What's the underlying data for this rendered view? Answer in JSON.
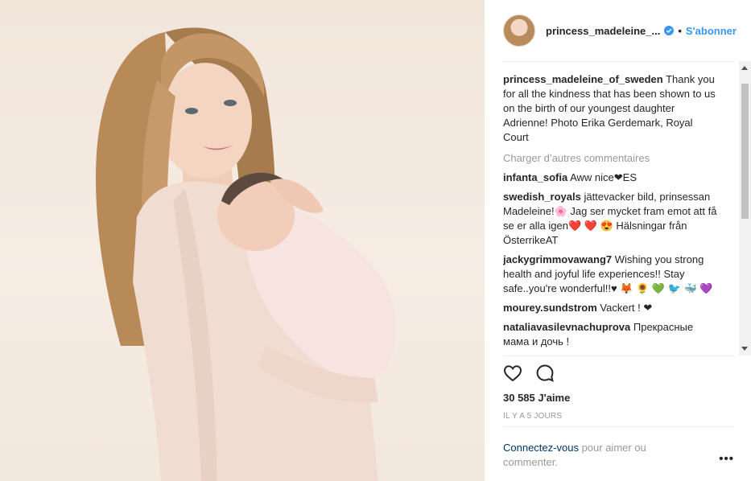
{
  "photo": {
    "alt": ""
  },
  "header": {
    "username": "princess_madeleine_...",
    "separator": "•",
    "follow_label": "S'abonner"
  },
  "caption": {
    "author": "princess_madeleine_of_sweden",
    "text": "Thank you for all the kindness that has been shown to us on the birth of our youngest daughter Adrienne! Photo Erika Gerdemark, Royal Court"
  },
  "load_more": "Charger d’autres commentaires",
  "comments": [
    {
      "author": "infanta_sofia",
      "text": "Aww nice❤ES"
    },
    {
      "author": "swedish_royals",
      "text": "jättevacker bild, prinsessan Madeleine!🌸 Jag ser mycket fram emot att få se er alla igen❤️ ❤️ 😍 Hälsningar från ÖsterrikeAT"
    },
    {
      "author": "jackygrimmovawang7",
      "text": "Wishing you strong health and joyful life experiences!! Stay safe..you're wonderful!!♥ 🦊 🌻 💚 🐦 🐳 💜"
    },
    {
      "author": "mourey.sundstrom",
      "text": "Vackert ! ❤"
    },
    {
      "author": "nataliavasilevnachuprova",
      "text": "Прекрасные мама и дочь !"
    }
  ],
  "likes": "30 585 J'aime",
  "timestamp": "IL Y A 5 JOURS",
  "login_prompt": {
    "link": "Connectez-vous",
    "text": " pour aimer ou commenter."
  },
  "more_options": "•••",
  "colors": {
    "accent": "#3897f0",
    "muted": "#999999",
    "link": "#003569"
  }
}
